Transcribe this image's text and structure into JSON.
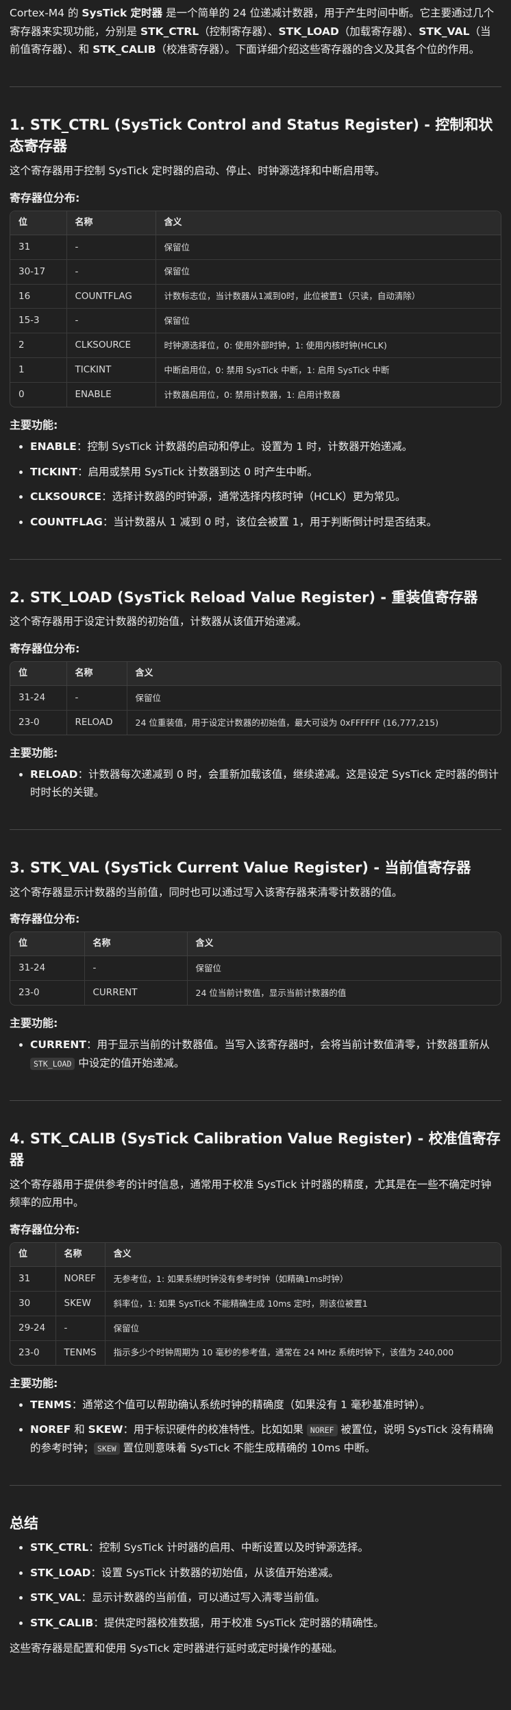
{
  "intro": {
    "p1": "Cortex-M4 的 ",
    "b1": "SysTick 定时器",
    "p2": " 是一个简单的 24 位递减计数器，用于产生时间中断。它主要通过几个寄存器来实现功能，分别是 ",
    "b2": "STK_CTRL",
    "p3": "（控制寄存器）、",
    "b3": "STK_LOAD",
    "p4": "（加载寄存器）、",
    "b4": "STK_VAL",
    "p5": "（当前值寄存器）、和 ",
    "b5": "STK_CALIB",
    "p6": "（校准寄存器）。下面详细介绍这些寄存器的含义及其各个位的作用。"
  },
  "headers": {
    "bit": "位",
    "name": "名称",
    "meaning": "含义"
  },
  "labels": {
    "layout": "寄存器位分布:",
    "functions": "主要功能:"
  },
  "sections": [
    {
      "title": "1. STK_CTRL (SysTick Control and Status Register) - 控制和状态寄存器",
      "desc": "这个寄存器用于控制 SysTick 定时器的启动、停止、时钟源选择和中断启用等。",
      "rows": [
        [
          "31",
          "-",
          "保留位"
        ],
        [
          "30-17",
          "-",
          "保留位"
        ],
        [
          "16",
          "COUNTFLAG",
          "计数标志位，当计数器从1减到0时，此位被置1（只读，自动清除）"
        ],
        [
          "15-3",
          "-",
          "保留位"
        ],
        [
          "2",
          "CLKSOURCE",
          "时钟源选择位，0: 使用外部时钟，1: 使用内核时钟(HCLK)"
        ],
        [
          "1",
          "TICKINT",
          "中断启用位，0: 禁用 SysTick 中断，1: 启用 SysTick 中断"
        ],
        [
          "0",
          "ENABLE",
          "计数器启用位，0: 禁用计数器，1: 启用计数器"
        ]
      ],
      "functions": [
        {
          "key": "ENABLE",
          "text": "：控制 SysTick 计数器的启动和停止。设置为 1 时，计数器开始递减。"
        },
        {
          "key": "TICKINT",
          "text": "：启用或禁用 SysTick 计数器到达 0 时产生中断。"
        },
        {
          "key": "CLKSOURCE",
          "text": "：选择计数器的时钟源，通常选择内核时钟（HCLK）更为常见。"
        },
        {
          "key": "COUNTFLAG",
          "text": "：当计数器从 1 减到 0 时，该位会被置 1，用于判断倒计时是否结束。"
        }
      ]
    },
    {
      "title": "2. STK_LOAD (SysTick Reload Value Register) - 重装值寄存器",
      "desc": "这个寄存器用于设定计数器的初始值，计数器从该值开始递减。",
      "rows": [
        [
          "31-24",
          "-",
          "保留位"
        ],
        [
          "23-0",
          "RELOAD",
          "24 位重装值，用于设定计数器的初始值，最大可设为 0xFFFFFF (16,777,215)"
        ]
      ],
      "functions": [
        {
          "key": "RELOAD",
          "text": "：计数器每次递减到 0 时，会重新加载该值，继续递减。这是设定 SysTick 定时器的倒计时时长的关键。"
        }
      ]
    },
    {
      "title": "3. STK_VAL (SysTick Current Value Register) - 当前值寄存器",
      "desc": "这个寄存器显示计数器的当前值，同时也可以通过写入该寄存器来清零计数器的值。",
      "rows": [
        [
          "31-24",
          "-",
          "保留位"
        ],
        [
          "23-0",
          "CURRENT",
          "24 位当前计数值，显示当前计数器的值"
        ]
      ],
      "functions": [
        {
          "key": "CURRENT",
          "text": "：用于显示当前的计数器值。当写入该寄存器时，会将当前计数值清零，计数器重新从 ",
          "code": "STK_LOAD",
          "after": " 中设定的值开始递减。"
        }
      ]
    },
    {
      "title": "4. STK_CALIB (SysTick Calibration Value Register) - 校准值寄存器",
      "desc": "这个寄存器用于提供参考的计时信息，通常用于校准 SysTick 计时器的精度，尤其是在一些不确定时钟频率的应用中。",
      "rows": [
        [
          "31",
          "NOREF",
          "无参考位，1: 如果系统时钟没有参考时钟（如精确1ms时钟）"
        ],
        [
          "30",
          "SKEW",
          "斜率位，1: 如果 SysTick 不能精确生成 10ms 定时，则该位被置1"
        ],
        [
          "29-24",
          "-",
          "保留位"
        ],
        [
          "23-0",
          "TENMS",
          "指示多少个时钟周期为 10 毫秒的参考值，通常在 24 MHz 系统时钟下，该值为 240,000"
        ]
      ],
      "functions": [
        {
          "key": "TENMS",
          "text": "：通常这个值可以帮助确认系统时钟的精确度（如果没有 1 毫秒基准时钟）。"
        },
        {
          "key": "NOREF",
          "mid": " 和 ",
          "key2": "SKEW",
          "text": "：用于标识硬件的校准特性。比如如果 ",
          "code": "NOREF",
          "after": " 被置位，说明 SysTick 没有精确的参考时钟；",
          "code2": "SKEW",
          "after2": " 置位则意味着 SysTick 不能生成精确的 10ms 中断。"
        }
      ]
    }
  ],
  "summary": {
    "title": "总结",
    "items": [
      {
        "key": "STK_CTRL",
        "text": "：控制 SysTick 计时器的启用、中断设置以及时钟源选择。"
      },
      {
        "key": "STK_LOAD",
        "text": "：设置 SysTick 计数器的初始值，从该值开始递减。"
      },
      {
        "key": "STK_VAL",
        "text": "：显示计数器的当前值，可以通过写入清零当前值。"
      },
      {
        "key": "STK_CALIB",
        "text": "：提供定时器校准数据，用于校准 SysTick 定时器的精确性。"
      }
    ],
    "closing": "这些寄存器是配置和使用 SysTick 定时器进行延时或定时操作的基础。"
  }
}
